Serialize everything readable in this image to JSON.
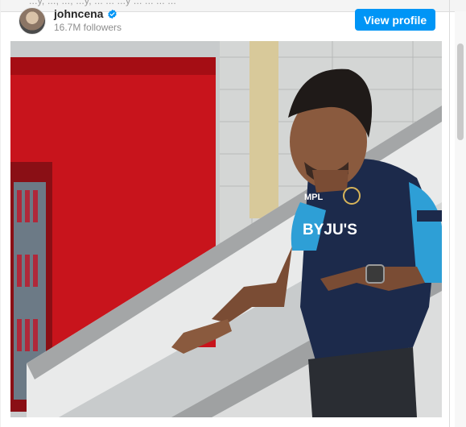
{
  "top_strip": {
    "clipped_text": "...y, ...,  ...,  ...y,  ...  ...  ...y  ...  ...  ...  ..."
  },
  "post": {
    "username": "johncena",
    "followers": "16.7M followers",
    "view_profile_label": "View profile",
    "verified": true
  },
  "photo": {
    "shirt_brand": "BYJU'S",
    "shirt_sponsor": "MPL"
  },
  "colors": {
    "accent": "#0095f6",
    "verified": "#0095f6"
  }
}
